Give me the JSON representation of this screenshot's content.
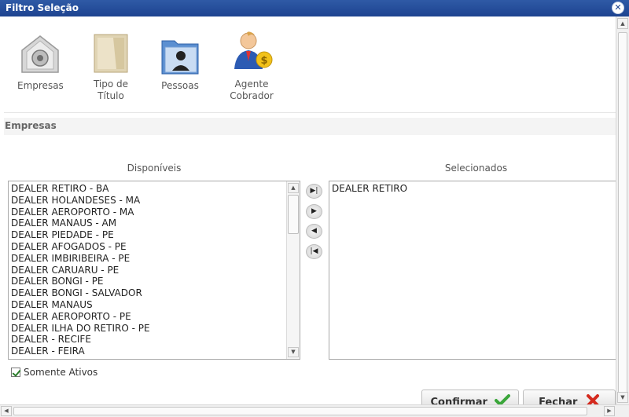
{
  "window": {
    "title": "Filtro Seleção"
  },
  "icon_bar": [
    {
      "id": "empresas",
      "label": "Empresas",
      "icon": "safe-icon"
    },
    {
      "id": "tipo-titulo",
      "label_line1": "Tipo de",
      "label_line2": "Título",
      "icon": "document-icon"
    },
    {
      "id": "pessoas",
      "label": "Pessoas",
      "icon": "person-folder-icon"
    },
    {
      "id": "agente-cobrador",
      "label_line1": "Agente",
      "label_line2": "Cobrador",
      "icon": "agent-money-icon"
    }
  ],
  "section": {
    "title": "Empresas"
  },
  "available": {
    "title": "Disponíveis",
    "items": [
      "DEALER RETIRO - BA",
      "DEALER HOLANDESES - MA",
      "DEALER AEROPORTO - MA",
      "DEALER MANAUS - AM",
      "DEALER PIEDADE - PE",
      "DEALER AFOGADOS - PE",
      "DEALER IMBIRIBEIRA - PE",
      "DEALER CARUARU - PE",
      "DEALER BONGI - PE",
      "DEALER BONGI - SALVADOR",
      "DEALER MANAUS",
      "DEALER AEROPORTO - PE",
      "DEALER ILHA DO RETIRO - PE",
      "DEALER - RECIFE",
      "DEALER - FEIRA"
    ]
  },
  "selected": {
    "title": "Selecionados",
    "items": [
      "DEALER RETIRO"
    ]
  },
  "move_buttons": {
    "move_all_right": "▶|",
    "move_right": "▶",
    "move_left": "◀",
    "move_all_left": "|◀"
  },
  "filter": {
    "somente_ativos_label": "Somente Ativos",
    "somente_ativos_checked": true
  },
  "actions": {
    "confirm_label": "Confirmar",
    "close_label": "Fechar"
  },
  "colors": {
    "titlebar": "#1d4390",
    "confirm_check": "#3aa63a",
    "close_x": "#d42a1e"
  }
}
